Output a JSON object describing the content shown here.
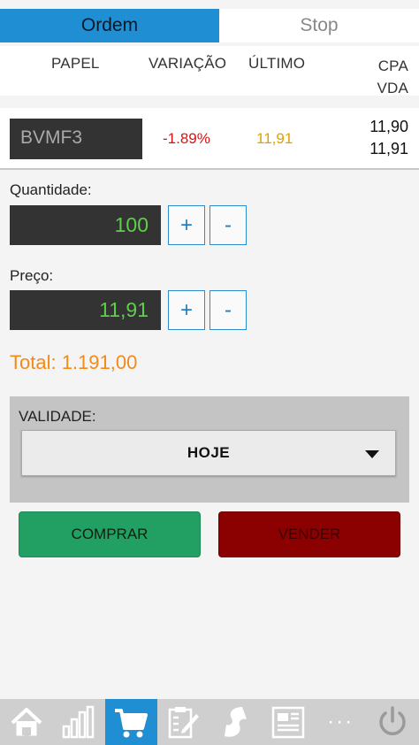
{
  "tabs": [
    {
      "label": "Ordem",
      "active": true
    },
    {
      "label": "Stop",
      "active": false
    }
  ],
  "table_header": {
    "papel": "PAPEL",
    "variacao": "VARIAÇÃO",
    "ultimo": "ÚLTIMO",
    "cpa": "CPA",
    "vda": "VDA"
  },
  "quote": {
    "ticker": "BVMF3",
    "variacao": "-1.89%",
    "ultimo": "11,91",
    "cpa": "11,90",
    "vda": "11,91"
  },
  "form": {
    "quantidade_label": "Quantidade:",
    "quantidade_value": "100",
    "preco_label": "Preço:",
    "preco_value": "11,91",
    "plus": "+",
    "minus": "-",
    "total": "Total: 1.191,00"
  },
  "validade": {
    "label": "VALIDADE:",
    "selected": "HOJE"
  },
  "actions": {
    "buy": "COMPRAR",
    "sell": "VENDER"
  },
  "bottom_nav": {
    "items": [
      "home-icon",
      "chart-icon",
      "cart-icon",
      "clipboard-icon",
      "stock-icon",
      "news-icon",
      "more-icon",
      "power-icon"
    ],
    "more_label": "···"
  },
  "colors": {
    "accent": "#1f8ed3",
    "negative": "#dd1111",
    "last": "#e0a000",
    "field_value": "#5fce4a",
    "total": "#f28a1a",
    "buy": "#22a064",
    "sell": "#8b0000"
  }
}
